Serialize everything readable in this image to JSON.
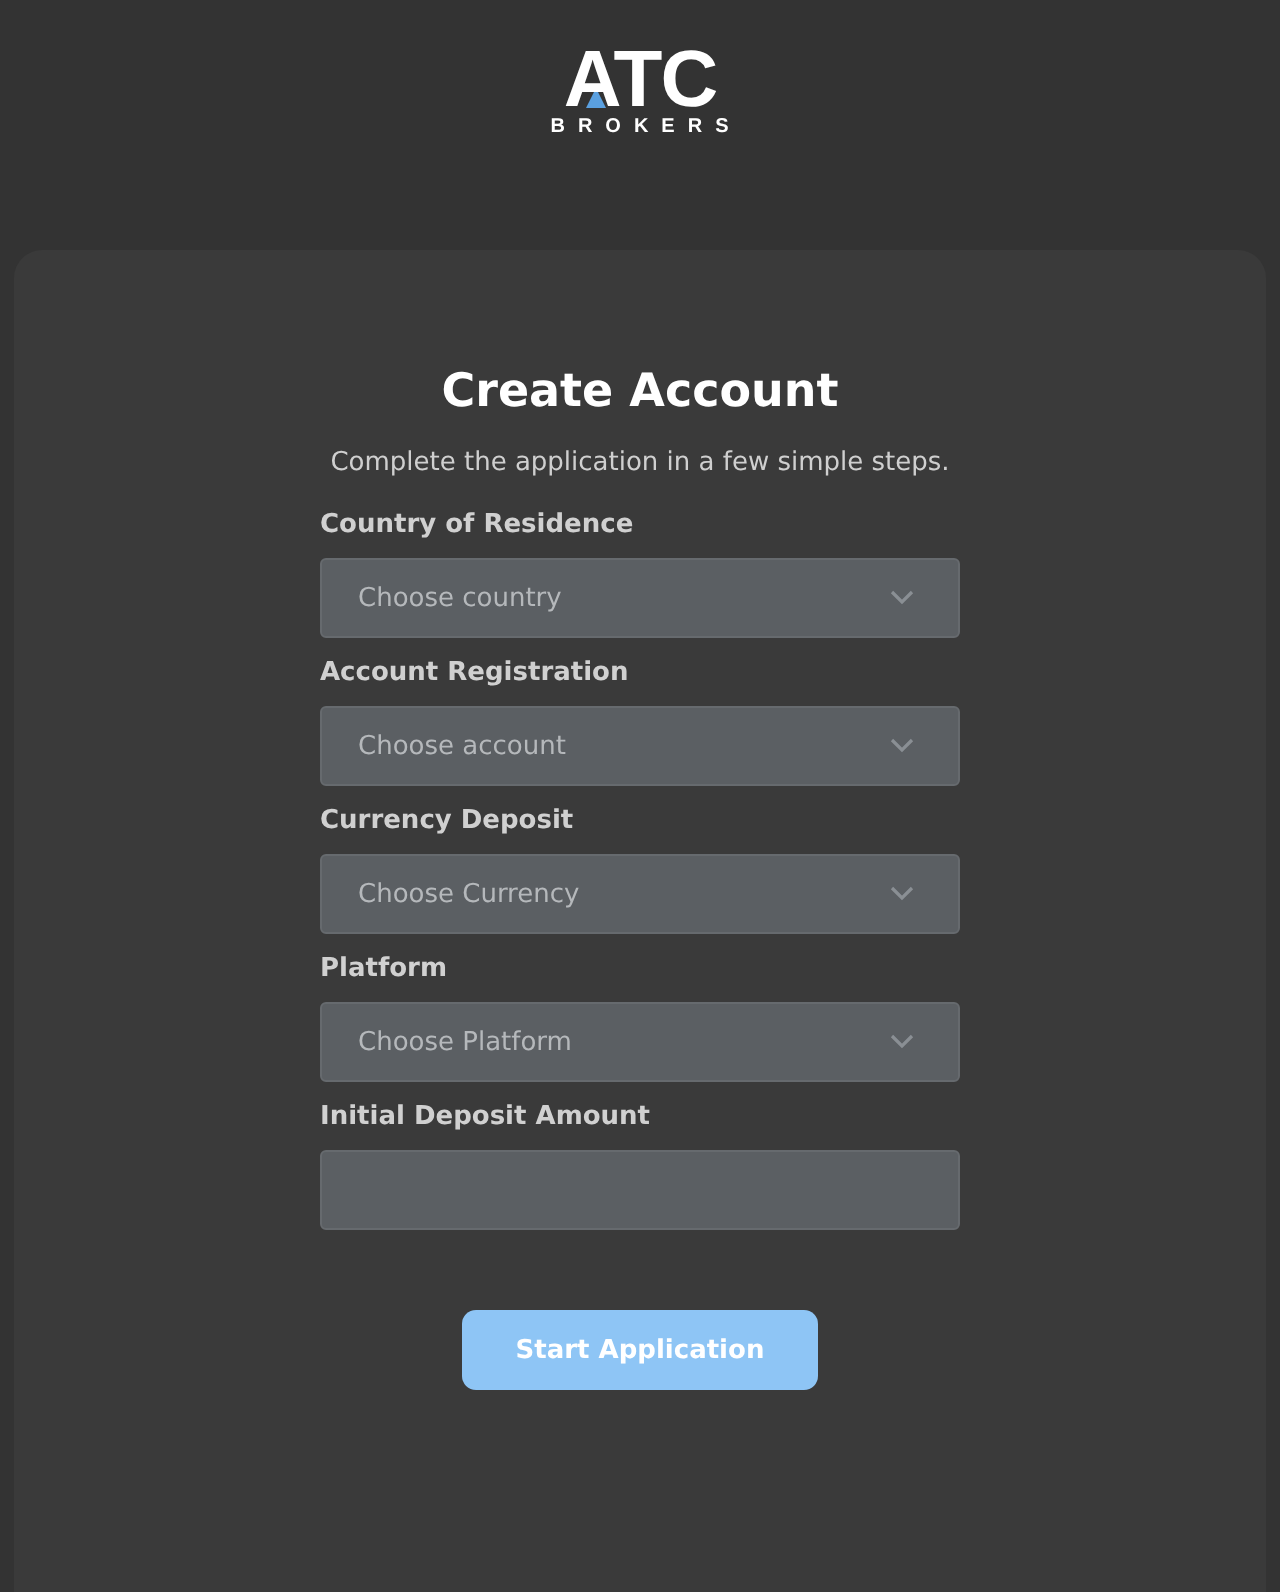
{
  "logo": {
    "mark": "ATC",
    "subtitle": "BROKERS"
  },
  "form": {
    "title": "Create Account",
    "subtitle": "Complete the application in a few simple steps.",
    "fields": [
      {
        "kind": "select",
        "label": "Country of Residence",
        "placeholder": "Choose country"
      },
      {
        "kind": "select",
        "label": "Account Registration",
        "placeholder": "Choose account"
      },
      {
        "kind": "select",
        "label": "Currency Deposit",
        "placeholder": "Choose Currency"
      },
      {
        "kind": "select",
        "label": "Platform",
        "placeholder": "Choose Platform"
      },
      {
        "kind": "input",
        "label": "Initial Deposit Amount"
      }
    ],
    "submit": "Start Application"
  }
}
